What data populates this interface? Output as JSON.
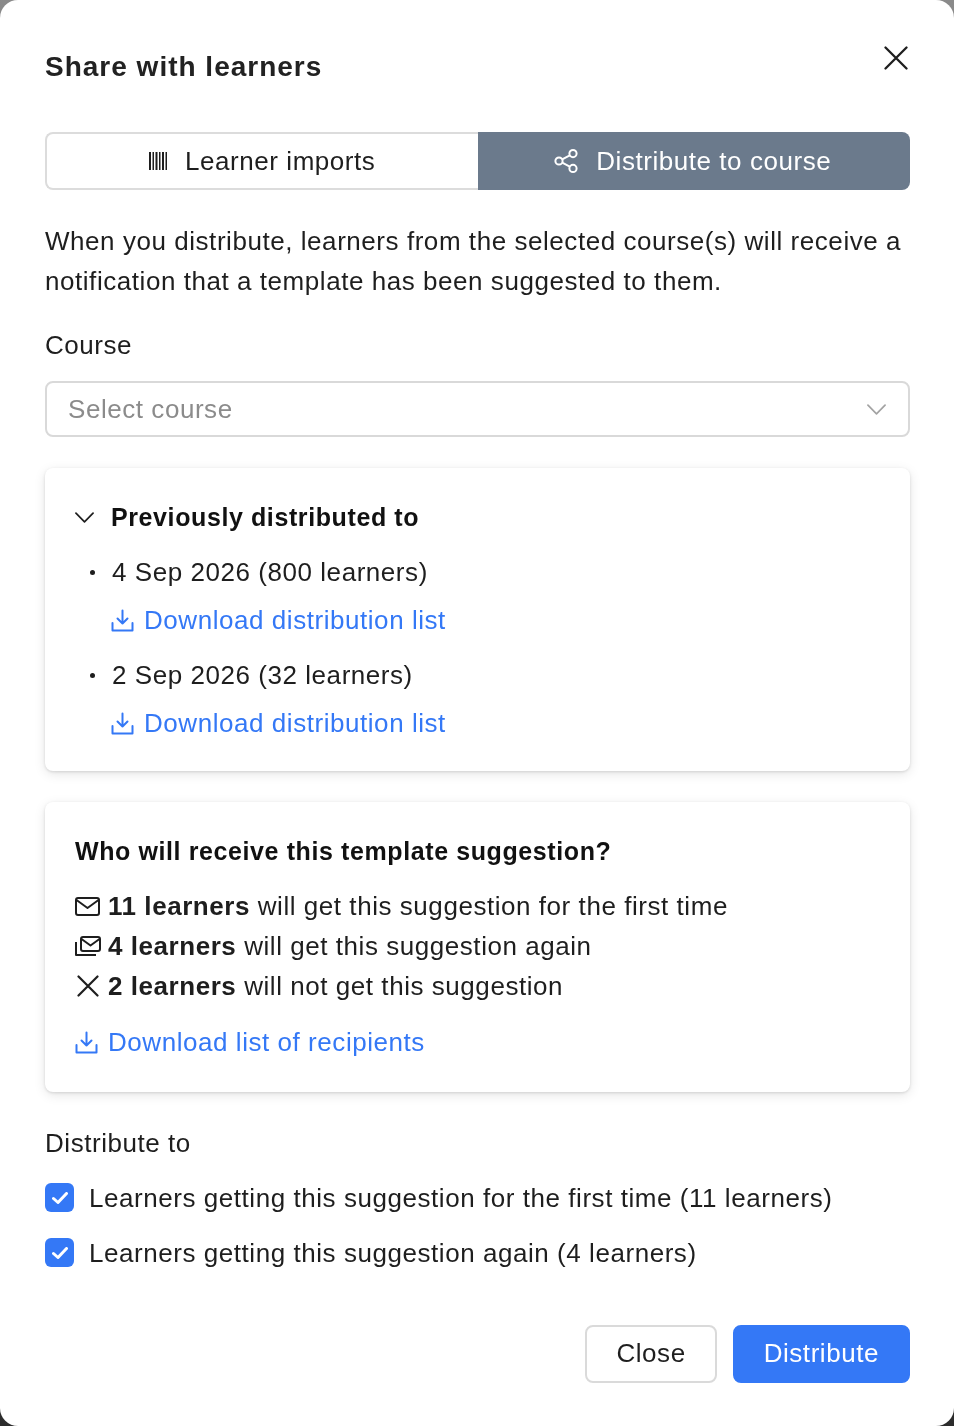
{
  "dialog": {
    "title": "Share with learners"
  },
  "tabs": [
    {
      "label": "Learner imports",
      "selected": false
    },
    {
      "label": "Distribute to course",
      "selected": true
    }
  ],
  "description": "When you distribute, learners from the selected course(s) will receive a notification that a template has been suggested to them.",
  "course": {
    "label": "Course",
    "placeholder": "Select course"
  },
  "history": {
    "title": "Previously distributed to",
    "expanded": true,
    "entries": [
      {
        "text": "4 Sep 2026 (800 learners)",
        "link": "Download distribution list"
      },
      {
        "text": "2 Sep 2026 (32 learners)",
        "link": "Download distribution list"
      }
    ]
  },
  "recipients": {
    "title": "Who will receive this template suggestion?",
    "lines": [
      {
        "kind": "new",
        "text": "**11 learners** will get this suggestion for the first time"
      },
      {
        "kind": "repeat",
        "text": "**4 learners** will get this suggestion again"
      },
      {
        "kind": "excluded",
        "text": "**2 learners** will not get this suggestion"
      }
    ],
    "link": "Download list of recipients"
  },
  "distribute_to": {
    "label": "Distribute to",
    "options": [
      {
        "label": "Learners getting this suggestion for the first time (11 learners)",
        "checked": true
      },
      {
        "label": "Learners getting this suggestion again (4 learners)",
        "checked": true
      }
    ]
  },
  "buttons": [
    {
      "label": "Close",
      "kind": "secondary"
    },
    {
      "label": "Distribute",
      "kind": "primary"
    }
  ]
}
